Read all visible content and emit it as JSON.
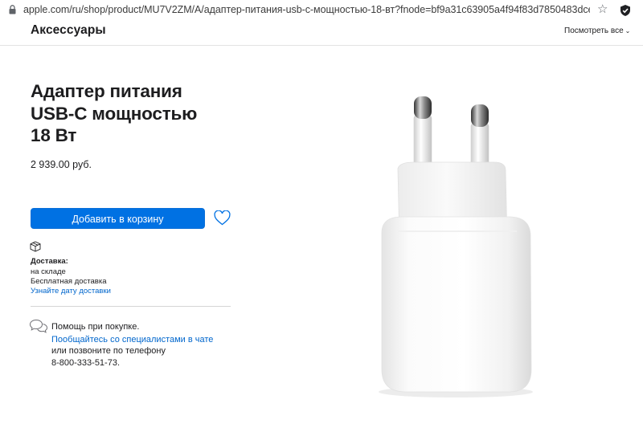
{
  "browser": {
    "url": "apple.com/ru/shop/product/MU7V2ZM/A/адаптер-питания-usb-c-мощностью-18-вт?fnode=bf9a31c63905a4f94f83d7850483dcefcb4b4..."
  },
  "header": {
    "title": "Аксессуары",
    "see_all": "Посмотреть все"
  },
  "product": {
    "title_lines": [
      "Адаптер питания",
      "USB-C мощностью",
      "18 Вт"
    ],
    "price": "2 939.00 руб.",
    "add_to_cart": "Добавить в корзину"
  },
  "delivery": {
    "heading": "Доставка:",
    "status": "на складе",
    "free": "Бесплатная доставка",
    "date_link": "Узнайте дату доставки"
  },
  "help": {
    "line1": "Помощь при покупке.",
    "chat_link": "Пообщайтесь со специалистами в чате",
    "line2": "или позвоните по телефону",
    "phone": "8-800-333-51-73."
  },
  "colors": {
    "button_blue": "#0071e3",
    "link_blue": "#0066cc",
    "text": "#1d1d1f"
  },
  "icons": [
    "lock-icon",
    "star-icon",
    "extension-icon",
    "chevron-down-icon",
    "heart-icon",
    "box-icon",
    "chat-icon"
  ]
}
